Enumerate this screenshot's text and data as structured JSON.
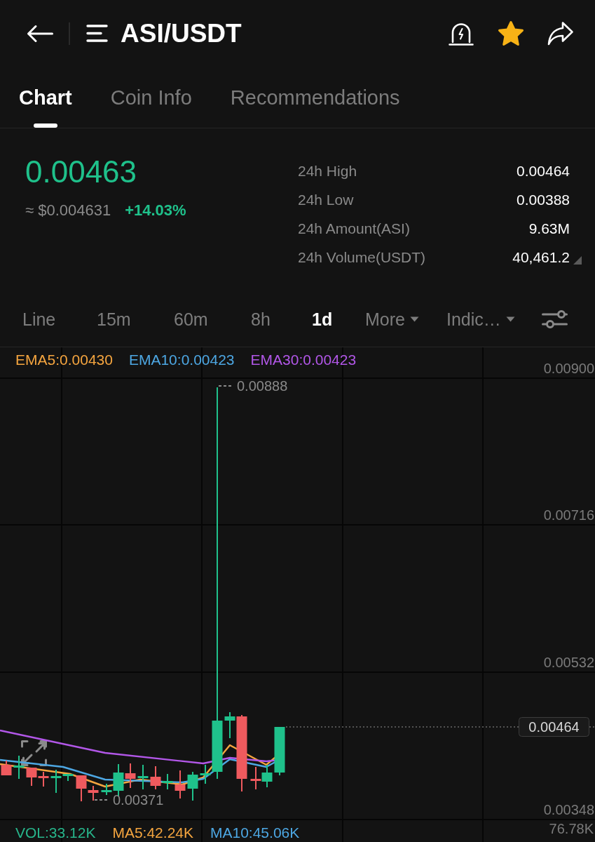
{
  "header": {
    "title": "ASI/USDT",
    "favorite": true
  },
  "tabs": [
    {
      "label": "Chart",
      "selected": true
    },
    {
      "label": "Coin Info",
      "selected": false
    },
    {
      "label": "Recommendations",
      "selected": false
    }
  ],
  "ticker": {
    "price": "0.00463",
    "fiat_price": "≈ $0.004631",
    "change": "+14.03%"
  },
  "stats": [
    {
      "label": "24h High",
      "value": "0.00464",
      "tooltip": false
    },
    {
      "label": "24h Low",
      "value": "0.00388",
      "tooltip": false
    },
    {
      "label": "24h Amount(ASI)",
      "value": "9.63M",
      "tooltip": false
    },
    {
      "label": "24h Volume(USDT)",
      "value": "40,461.2",
      "tooltip": true
    }
  ],
  "intervals": [
    {
      "label": "Line",
      "kind": "option",
      "selected": false
    },
    {
      "label": "15m",
      "kind": "option",
      "selected": false
    },
    {
      "label": "60m",
      "kind": "option",
      "selected": false
    },
    {
      "label": "8h",
      "kind": "option",
      "selected": false
    },
    {
      "label": "1d",
      "kind": "option",
      "selected": true
    },
    {
      "label": "More",
      "kind": "dropdown",
      "selected": false
    },
    {
      "label": "Indic…",
      "kind": "dropdown",
      "selected": false
    }
  ],
  "chart": {
    "legend": [
      {
        "label": "EMA5:0.00430",
        "color": "#f5a53f"
      },
      {
        "label": "EMA10:0.00423",
        "color": "#4da7e3"
      },
      {
        "label": "EMA30:0.00423",
        "color": "#b257e8"
      }
    ],
    "price_axis": [
      "0.00900",
      "0.00716",
      "0.00532",
      "0.00348"
    ],
    "high_marker": "0.00888",
    "low_marker": "0.00371",
    "last_price": "0.00464"
  },
  "volume": {
    "legend": [
      {
        "label": "VOL:33.12K",
        "color": "#27b58b"
      },
      {
        "label": "MA5:42.24K",
        "color": "#f5a53f"
      },
      {
        "label": "MA10:45.06K",
        "color": "#4da7e3"
      }
    ],
    "axis_label": "76.78K"
  }
}
